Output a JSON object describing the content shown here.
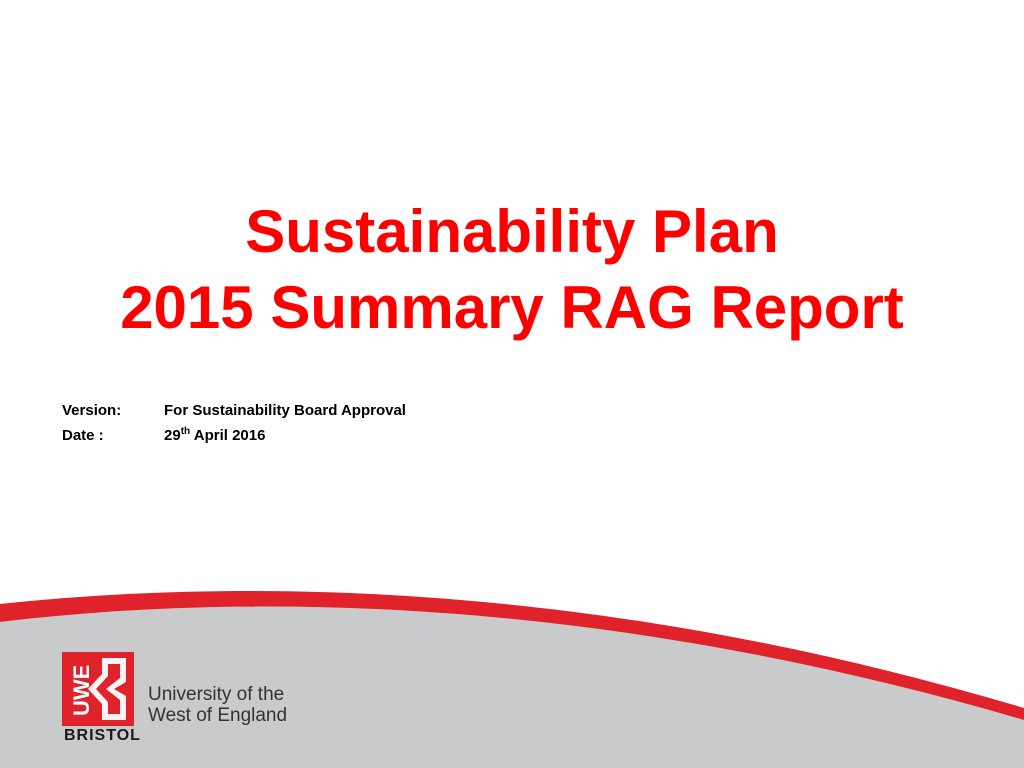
{
  "slide": {
    "title_line1": "Sustainability Plan",
    "title_line2": "2015 Summary RAG Report",
    "version_label": "Version:",
    "version_value": "For Sustainability Board Approval",
    "date_label": "Date :",
    "date_day": "29",
    "date_suffix": "th",
    "date_rest": " April 2016"
  },
  "logo": {
    "mark_text": "UWE",
    "bristol": "BRISTOL",
    "name_line1": "University of the",
    "name_line2": "West of England"
  },
  "colors": {
    "accent_red": "#ff0000",
    "band_red": "#e0232b",
    "band_grey": "#c8cacc",
    "text": "#000000"
  }
}
